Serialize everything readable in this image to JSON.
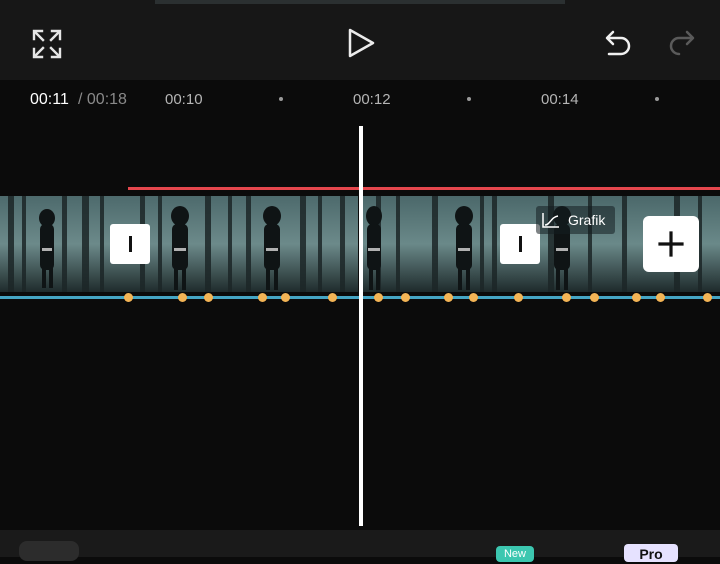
{
  "toolbar": {
    "fullscreen_icon": "fullscreen-icon",
    "play_icon": "play-icon",
    "undo_icon": "undo-icon",
    "redo_icon": "redo-icon"
  },
  "timeline": {
    "current_time": "00:11",
    "total_time": "/ 00:18",
    "ticks": [
      "00:10",
      "00:12",
      "00:14"
    ]
  },
  "track": {
    "effect_label": "Grafik",
    "effect_icon": "graph-icon",
    "add_icon": "plus-icon"
  },
  "bottom": {
    "new_badge": "New",
    "pro_badge": "Pro"
  },
  "colors": {
    "audio_line": "#e5474d",
    "keyframe": "#f3b455",
    "track_line": "#45a5c4",
    "new_badge": "#3cc7b0"
  }
}
